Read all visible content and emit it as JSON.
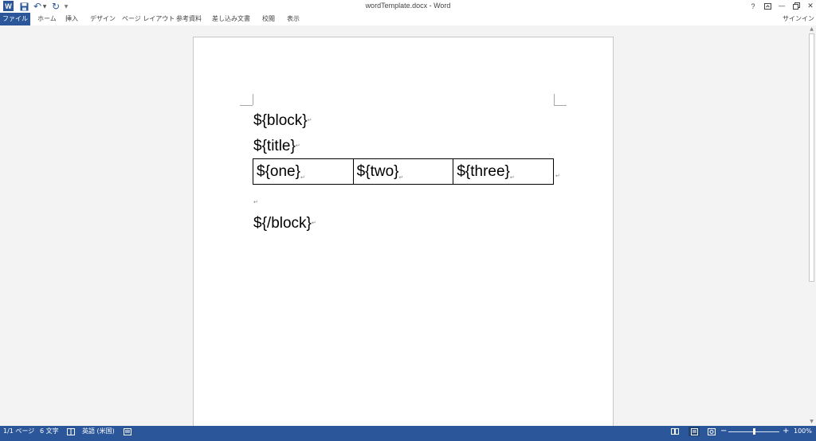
{
  "window": {
    "title": "wordTemplate.docx - Word",
    "app_icon_letter": "W",
    "help": "?"
  },
  "quick_access": {
    "icons": [
      "save-icon",
      "undo-icon",
      "redo-icon"
    ]
  },
  "ribbon": {
    "tabs": [
      {
        "label": "ファイル",
        "active": true
      },
      {
        "label": "ホーム"
      },
      {
        "label": "挿入"
      },
      {
        "label": "デザイン"
      },
      {
        "label": "ページ レイアウト"
      },
      {
        "label": "参考資料"
      },
      {
        "label": "差し込み文書"
      },
      {
        "label": "校閲"
      },
      {
        "label": "表示"
      }
    ],
    "signin": "サインイン"
  },
  "document": {
    "paragraphs": {
      "block_start": "${block}",
      "title": "${title}",
      "block_end": "${/block}"
    },
    "table": {
      "rows": [
        [
          "${one}",
          "${two}",
          "${three}"
        ]
      ]
    },
    "formatting_mark": "↵"
  },
  "status_bar": {
    "page": "1/1 ページ",
    "words": "6 文字",
    "language": "英語 (米国)",
    "zoom": "100%",
    "zoom_fraction": 0.5
  },
  "colors": {
    "accent": "#2b579a",
    "page_background": "#ffffff",
    "workspace": "#f3f3f3"
  }
}
